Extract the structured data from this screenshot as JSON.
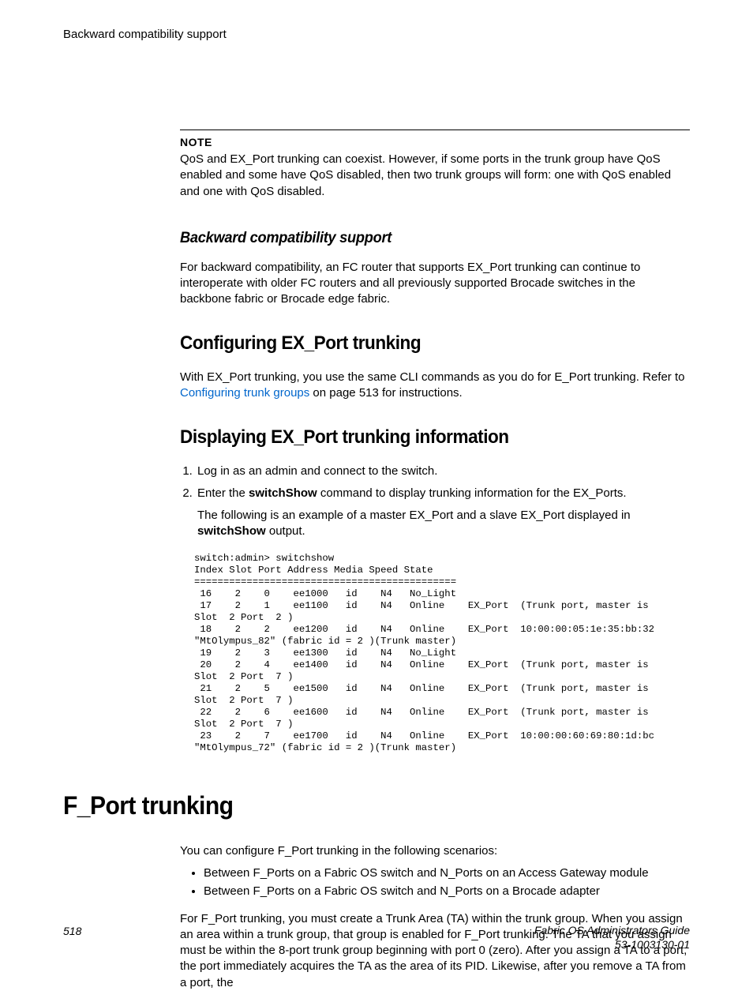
{
  "running_header": "Backward compatibility support",
  "note": {
    "label": "NOTE",
    "body": "QoS and EX_Port trunking can coexist. However, if some ports in the trunk group have QoS enabled and some have QoS disabled, then two trunk groups will form: one with QoS enabled and one with QoS disabled."
  },
  "section_backcompat": {
    "heading": "Backward compatibility support",
    "para": "For backward compatibility, an FC router that supports EX_Port trunking can continue to interoperate with older FC routers and all previously supported Brocade switches in the backbone fabric or Brocade edge fabric."
  },
  "section_config": {
    "heading": "Configuring EX_Port trunking",
    "para_pre": "With EX_Port trunking, you use the same CLI commands as you do for E_Port trunking. Refer to ",
    "link_text": "Configuring trunk groups",
    "para_post": " on page 513 for instructions."
  },
  "section_display": {
    "heading": "Displaying EX_Port trunking information",
    "step1": "Log in as an admin and connect to the switch.",
    "step2_pre": "Enter the ",
    "step2_cmd": "switchShow",
    "step2_post": " command to display trunking information for the EX_Ports.",
    "step2_sub_pre": "The following is an example of a master EX_Port and a slave EX_Port displayed in ",
    "step2_sub_bold": "switchShow",
    "step2_sub_post": " output.",
    "cli": "switch:admin> switchshow\nIndex Slot Port Address Media Speed State\n=============================================\n 16    2    0    ee1000   id    N4   No_Light\n 17    2    1    ee1100   id    N4   Online    EX_Port  (Trunk port, master is\nSlot  2 Port  2 )\n 18    2    2    ee1200   id    N4   Online    EX_Port  10:00:00:05:1e:35:bb:32\n\"MtOlympus_82\" (fabric id = 2 )(Trunk master)\n 19    2    3    ee1300   id    N4   No_Light\n 20    2    4    ee1400   id    N4   Online    EX_Port  (Trunk port, master is\nSlot  2 Port  7 )\n 21    2    5    ee1500   id    N4   Online    EX_Port  (Trunk port, master is\nSlot  2 Port  7 )\n 22    2    6    ee1600   id    N4   Online    EX_Port  (Trunk port, master is\nSlot  2 Port  7 )\n 23    2    7    ee1700   id    N4   Online    EX_Port  10:00:00:60:69:80:1d:bc\n\"MtOlympus_72\" (fabric id = 2 )(Trunk master)"
  },
  "section_fport": {
    "heading": "F_Port trunking",
    "intro": "You can configure F_Port trunking in the following scenarios:",
    "bullets": [
      "Between F_Ports on a Fabric OS switch and N_Ports on an Access Gateway module",
      "Between F_Ports on a Fabric OS switch and N_Ports on a Brocade adapter"
    ],
    "para": "For F_Port trunking, you must create a Trunk Area (TA) within the trunk group. When you assign an area within a trunk group, that group is enabled for F_Port trunking. The TA that you assign must be within the 8-port trunk group beginning with port 0 (zero). After you assign a TA to a port, the port immediately acquires the TA as the area of its PID. Likewise, after you remove a TA from a port, the"
  },
  "footer": {
    "page": "518",
    "title": "Fabric OS Administrators Guide",
    "docnum": "53-1003130-01"
  }
}
